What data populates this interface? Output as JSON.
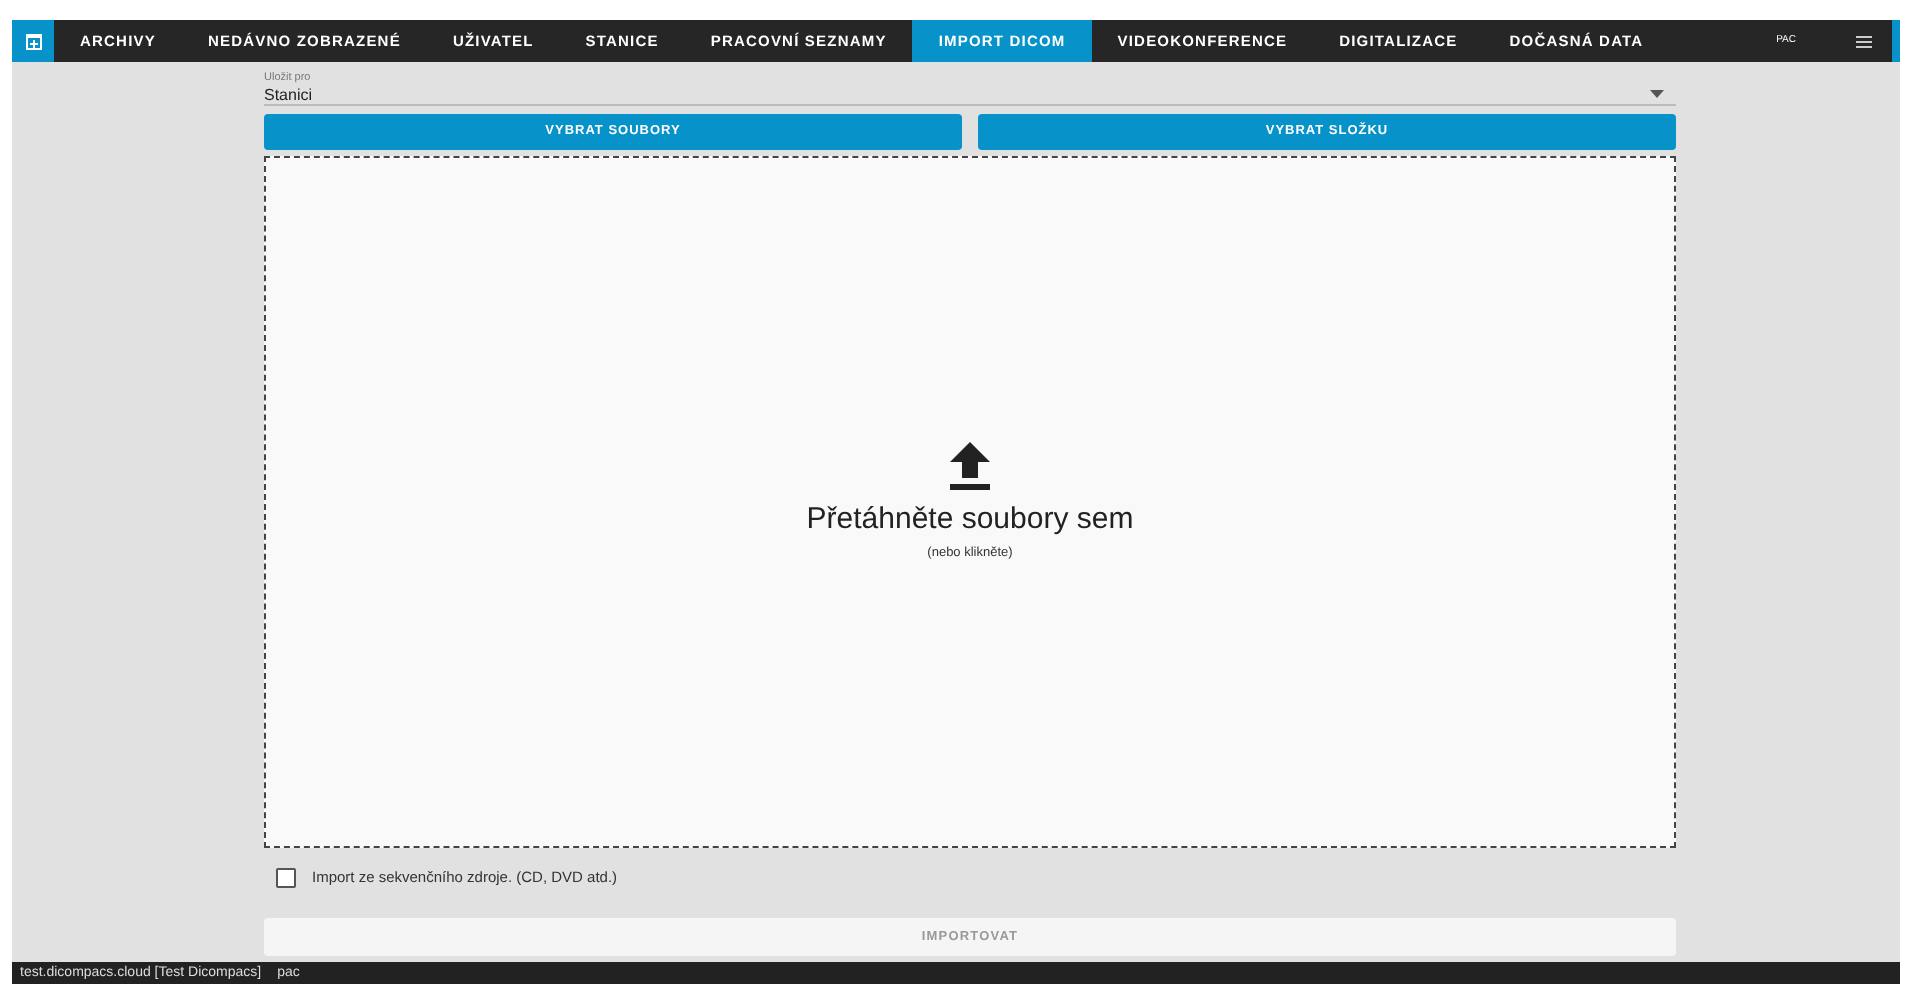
{
  "nav": {
    "tabs": [
      {
        "label": "ARCHIVY",
        "selected": false
      },
      {
        "label": "NEDÁVNO ZOBRAZENÉ",
        "selected": false
      },
      {
        "label": "UŽIVATEL",
        "selected": false
      },
      {
        "label": "STANICE",
        "selected": false
      },
      {
        "label": "PRACOVNÍ SEZNAMY",
        "selected": false
      },
      {
        "label": "IMPORT DICOM",
        "selected": true
      },
      {
        "label": "VIDEOKONFERENCE",
        "selected": false
      },
      {
        "label": "DIGITALIZACE",
        "selected": false
      },
      {
        "label": "DOČASNÁ DATA",
        "selected": false
      }
    ],
    "user": "PAC"
  },
  "save_for": {
    "label": "Uložit pro",
    "value": "Stanici"
  },
  "buttons": [
    "VYBRAT SOUBORY",
    "VYBRAT SLOŽKU"
  ],
  "dropzone": {
    "title": "Přetáhněte soubory sem",
    "hint": "(nebo klikněte)"
  },
  "sequential_import": {
    "label": "Import ze sekvenčního zdroje. (CD, DVD atd.)",
    "checked": false
  },
  "import_button": {
    "label": "IMPORTOVAT",
    "disabled": true
  },
  "status_bar": {
    "site": "test.dicompacs.cloud [Test Dicompacs]",
    "user": "pac"
  }
}
